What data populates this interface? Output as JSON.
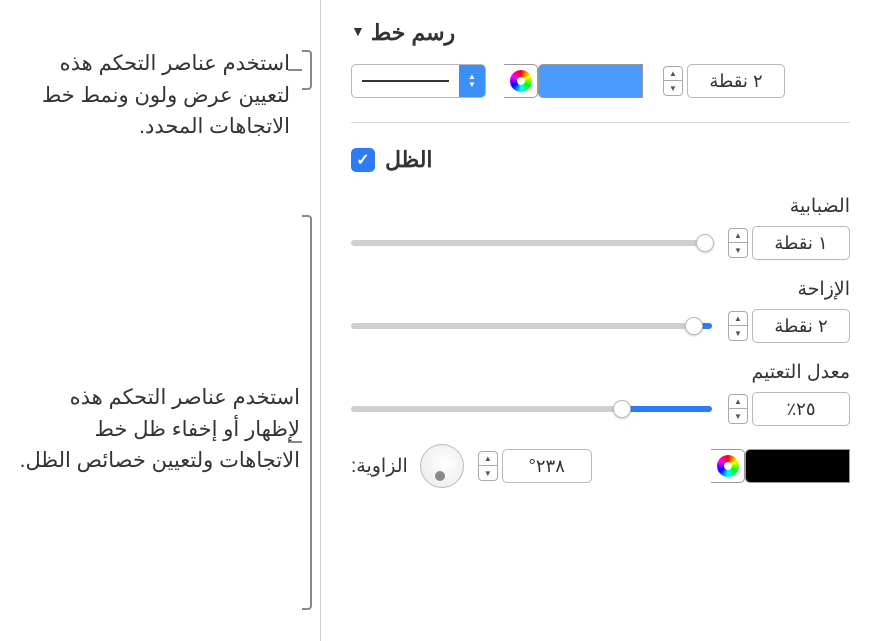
{
  "stroke": {
    "title": "رسم خط",
    "width_value": "٢ نقطة"
  },
  "shadow": {
    "title": "الظل",
    "blur_label": "الضبابية",
    "blur_value": "١ نقطة",
    "blur_percent": 2,
    "offset_label": "الإزاحة",
    "offset_value": "٢ نقطة",
    "offset_percent": 5,
    "opacity_label": "معدل التعتيم",
    "opacity_value": "٢٥٪",
    "opacity_percent": 25,
    "angle_label": "الزاوية:",
    "angle_value": "٢٣٨°"
  },
  "callouts": {
    "stroke": "استخدم عناصر التحكم هذه لتعيين عرض ولون ونمط خط الاتجاهات المحدد.",
    "shadow": "استخدم عناصر التحكم هذه لإظهار أو إخفاء ظل خط الاتجاهات ولتعيين خصائص الظل."
  }
}
